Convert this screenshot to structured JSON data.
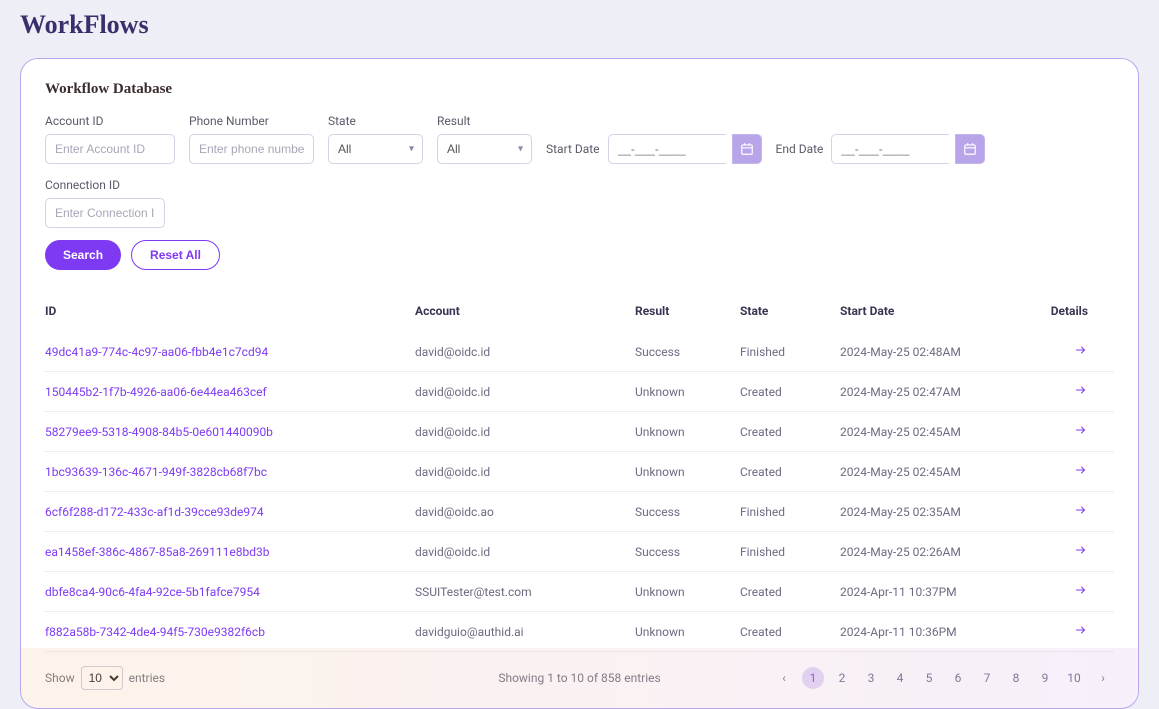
{
  "page": {
    "title": "WorkFlows"
  },
  "card": {
    "title": "Workflow Database"
  },
  "filters": {
    "account_id": {
      "label": "Account ID",
      "placeholder": "Enter Account ID"
    },
    "phone": {
      "label": "Phone Number",
      "placeholder": "Enter phone number"
    },
    "state": {
      "label": "State",
      "value": "All"
    },
    "result": {
      "label": "Result",
      "value": "All"
    },
    "start_date": {
      "label": "Start Date",
      "placeholder": "__-___-____"
    },
    "end_date": {
      "label": "End Date",
      "placeholder": "__-___-____"
    },
    "connection_id": {
      "label": "Connection ID",
      "placeholder": "Enter Connection ID here"
    },
    "search_label": "Search",
    "reset_label": "Reset All"
  },
  "table": {
    "headers": {
      "id": "ID",
      "account": "Account",
      "result": "Result",
      "state": "State",
      "start_date": "Start Date",
      "details": "Details"
    },
    "rows": [
      {
        "id": "49dc41a9-774c-4c97-aa06-fbb4e1c7cd94",
        "account": "david@oidc.id",
        "result": "Success",
        "state": "Finished",
        "start_date": "2024-May-25 02:48AM"
      },
      {
        "id": "150445b2-1f7b-4926-aa06-6e44ea463cef",
        "account": "david@oidc.id",
        "result": "Unknown",
        "state": "Created",
        "start_date": "2024-May-25 02:47AM"
      },
      {
        "id": "58279ee9-5318-4908-84b5-0e601440090b",
        "account": "david@oidc.id",
        "result": "Unknown",
        "state": "Created",
        "start_date": "2024-May-25 02:45AM"
      },
      {
        "id": "1bc93639-136c-4671-949f-3828cb68f7bc",
        "account": "david@oidc.id",
        "result": "Unknown",
        "state": "Created",
        "start_date": "2024-May-25 02:45AM"
      },
      {
        "id": "6cf6f288-d172-433c-af1d-39cce93de974",
        "account": "david@oidc.ao",
        "result": "Success",
        "state": "Finished",
        "start_date": "2024-May-25 02:35AM"
      },
      {
        "id": "ea1458ef-386c-4867-85a8-269111e8bd3b",
        "account": "david@oidc.id",
        "result": "Success",
        "state": "Finished",
        "start_date": "2024-May-25 02:26AM"
      },
      {
        "id": "dbfe8ca4-90c6-4fa4-92ce-5b1fafce7954",
        "account": "SSUITester@test.com",
        "result": "Unknown",
        "state": "Created",
        "start_date": "2024-Apr-11 10:37PM"
      },
      {
        "id": "f882a58b-7342-4de4-94f5-730e9382f6cb",
        "account": "davidguio@authid.ai",
        "result": "Unknown",
        "state": "Created",
        "start_date": "2024-Apr-11 10:36PM"
      }
    ]
  },
  "footer": {
    "show_label": "Show",
    "page_size": "10",
    "entries_label": "entries",
    "info": "Showing 1 to 10 of 858 entries",
    "pages": [
      "1",
      "2",
      "3",
      "4",
      "5",
      "6",
      "7",
      "8",
      "9",
      "10"
    ],
    "active_page": "1",
    "prev": "‹",
    "next": "›"
  }
}
